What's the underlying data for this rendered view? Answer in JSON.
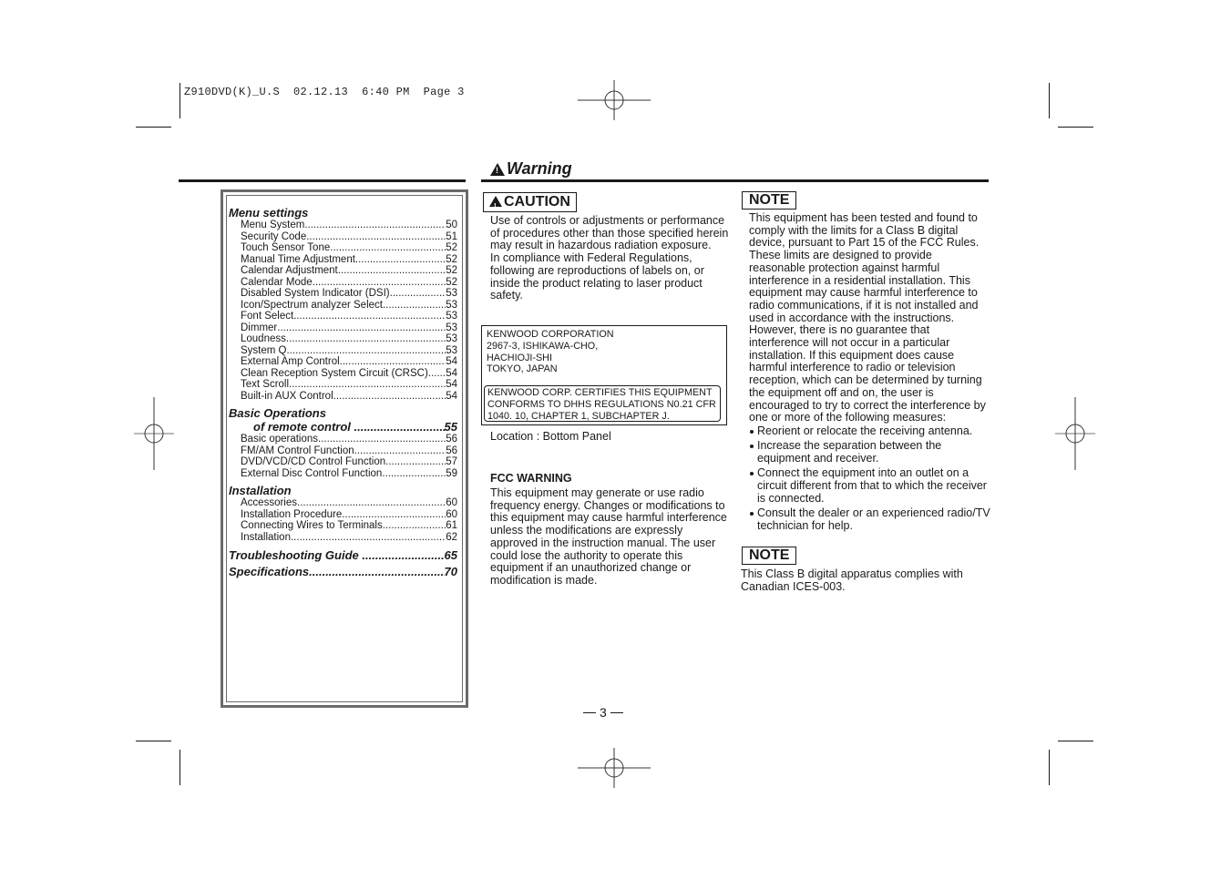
{
  "slug": {
    "file": "Z910DVD(K)_U.S",
    "date": "02.12.13",
    "time": "6:40 PM",
    "page_label": "Page 3"
  },
  "toc": {
    "sections": [
      {
        "heading": "Menu settings",
        "items": [
          {
            "title": "Menu System",
            "page": "50"
          },
          {
            "title": "Security Code",
            "page": "51"
          },
          {
            "title": "Touch Sensor Tone",
            "page": "52"
          },
          {
            "title": "Manual Time Adjustment",
            "page": "52"
          },
          {
            "title": "Calendar Adjustment",
            "page": "52"
          },
          {
            "title": "Calendar Mode",
            "page": "52"
          },
          {
            "title": "Disabled System Indicator (DSI)",
            "page": "53"
          },
          {
            "title": "Icon/Spectrum analyzer Select",
            "page": "53"
          },
          {
            "title": "Font Select",
            "page": "53"
          },
          {
            "title": "Dimmer",
            "page": "53"
          },
          {
            "title": "Loudness",
            "page": "53"
          },
          {
            "title": "System Q",
            "page": "53"
          },
          {
            "title": "External Amp Control",
            "page": "54"
          },
          {
            "title": "Clean Reception System Circuit (CRSC)",
            "page": "54"
          },
          {
            "title": "Text Scroll",
            "page": "54"
          },
          {
            "title": "Built-in AUX Control",
            "page": "54"
          }
        ]
      },
      {
        "heading": "Basic Operations",
        "heading_line2": "of remote control",
        "heading_page": "55",
        "items": [
          {
            "title": "Basic operations",
            "page": "56"
          },
          {
            "title": "FM/AM Control Function",
            "page": "56"
          },
          {
            "title": "DVD/VCD/CD Control Function",
            "page": "57"
          },
          {
            "title": "External Disc Control Function",
            "page": "59"
          }
        ]
      },
      {
        "heading": "Installation",
        "items": [
          {
            "title": "Accessories",
            "page": "60"
          },
          {
            "title": "Installation Procedure",
            "page": "60"
          },
          {
            "title": "Connecting Wires to Terminals",
            "page": "61"
          },
          {
            "title": "Installation",
            "page": "62"
          }
        ]
      }
    ],
    "major": [
      {
        "title": "Troubleshooting Guide",
        "page": "65"
      },
      {
        "title": "Specifications",
        "page": "70"
      }
    ]
  },
  "warning": {
    "title": "Warning",
    "caution_label": "CAUTION",
    "caution_text": "Use of controls or adjustments or performance of procedures other than those specified herein may result in hazardous radiation exposure.\nIn compliance with Federal Regulations, following are reproductions of labels on, or inside the product relating to laser product safety.",
    "label_address": "KENWOOD CORPORATION\n2967-3, ISHIKAWA-CHO,\nHACHIOJI-SHI\nTOKYO, JAPAN",
    "label_cert": "KENWOOD CORP. CERTIFIES THIS EQUIPMENT\nCONFORMS TO DHHS REGULATIONS N0.21 CFR\n1040. 10, CHAPTER 1, SUBCHAPTER J.",
    "location": "Location : Bottom Panel",
    "fcc_title": "FCC WARNING",
    "fcc_text": "This equipment may generate or use radio frequency energy.  Changes or modifications to this equipment may cause harmful interference unless the modifications are expressly approved in the instruction manual. The user could lose the authority to operate this equipment if an unauthorized change or modification is made."
  },
  "note1": {
    "label": "NOTE",
    "text": "This equipment has been tested and found to comply with the limits for a Class B digital device, pursuant to Part 15 of the FCC Rules. These limits are designed to provide reasonable protection against harmful interference in a residential installation.  This equipment may cause harmful interference to radio communications, if it is not installed and used in accordance with the instructions. However, there is no guarantee that interference will not occur in a particular installation.  If this equipment does cause harmful interference to radio or television reception, which can be determined by turning the equipment off and on, the user is encouraged to try to correct the interference by one or more of the following measures:",
    "bullets": [
      "Reorient or relocate the receiving antenna.",
      "Increase the separation between the equipment and receiver.",
      "Connect the equipment into an outlet on a circuit different from that to which the receiver is connected.",
      "Consult the dealer or an experienced radio/TV technician for help."
    ]
  },
  "note2": {
    "label": "NOTE",
    "text": "This Class B digital apparatus complies with Canadian ICES-003."
  },
  "footer": {
    "page_number": "3"
  }
}
